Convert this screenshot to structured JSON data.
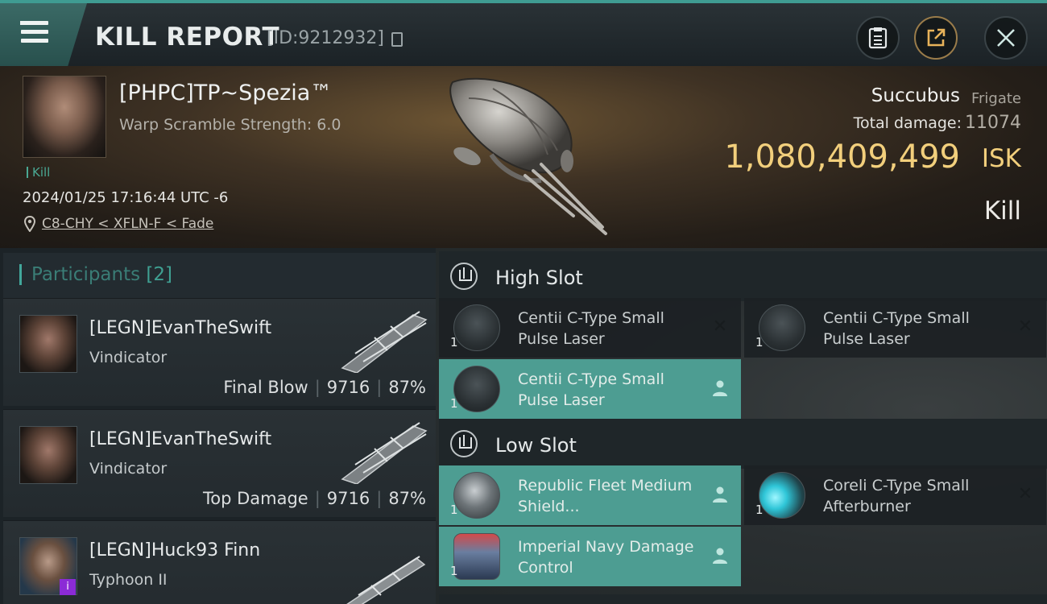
{
  "topbar": {
    "title": "KILL REPORT",
    "report_id": "[ID:9212932]"
  },
  "victim": {
    "name": "[PHPC]TP~Spezia™",
    "warp_scramble": "Warp Scramble Strength: 6.0",
    "tag": "Kill",
    "timestamp": "2024/01/25 17:16:44 UTC -6",
    "location": "C8-CHY < XFLN-F < Fade",
    "ship_name": "Succubus",
    "ship_class": "Frigate",
    "total_damage_label": "Total damage:",
    "total_damage": "11074",
    "isk_value": "1,080,409,499",
    "isk_unit": "ISK",
    "result": "Kill"
  },
  "participants": {
    "title": "Participants",
    "count": "[2]",
    "rows": [
      {
        "name": "[LEGN]EvanTheSwift",
        "ship": "Vindicator",
        "role": "Final Blow",
        "damage": "9716",
        "percent": "87%"
      },
      {
        "name": "[LEGN]EvanTheSwift",
        "ship": "Vindicator",
        "role": "Top Damage",
        "damage": "9716",
        "percent": "87%"
      },
      {
        "name": "[LEGN]Huck93 Finn",
        "ship": "Typhoon II"
      }
    ]
  },
  "fitting": {
    "high_slot": {
      "title": "High Slot",
      "modules": [
        {
          "qty": "1",
          "name": "Centii C-Type Small Pulse Laser",
          "status": "destroyed"
        },
        {
          "qty": "1",
          "name": "Centii C-Type Small Pulse Laser",
          "status": "destroyed"
        },
        {
          "qty": "1",
          "name": "Centii C-Type Small Pulse Laser",
          "status": "dropped"
        }
      ]
    },
    "low_slot": {
      "title": "Low Slot",
      "modules": [
        {
          "qty": "1",
          "name": "Republic Fleet Medium Shield...",
          "status": "dropped"
        },
        {
          "qty": "1",
          "name": "Coreli C-Type Small Afterburner",
          "status": "destroyed"
        },
        {
          "qty": "1",
          "name": "Imperial Navy Damage Control",
          "status": "dropped"
        }
      ]
    }
  },
  "icons": {
    "menu": "hamburger-menu-icon",
    "copy": "copy-icon",
    "clipboard": "clipboard-icon",
    "share": "share-icon",
    "close": "close-icon",
    "location": "location-pin-icon",
    "destroyed": "x-mark-icon",
    "dropped": "person-icon"
  },
  "colors": {
    "accent": "#3fa092",
    "isk": "#f2cf7c",
    "dropped_bg": "#4d9d92",
    "kill_tag": "#4aa893"
  }
}
